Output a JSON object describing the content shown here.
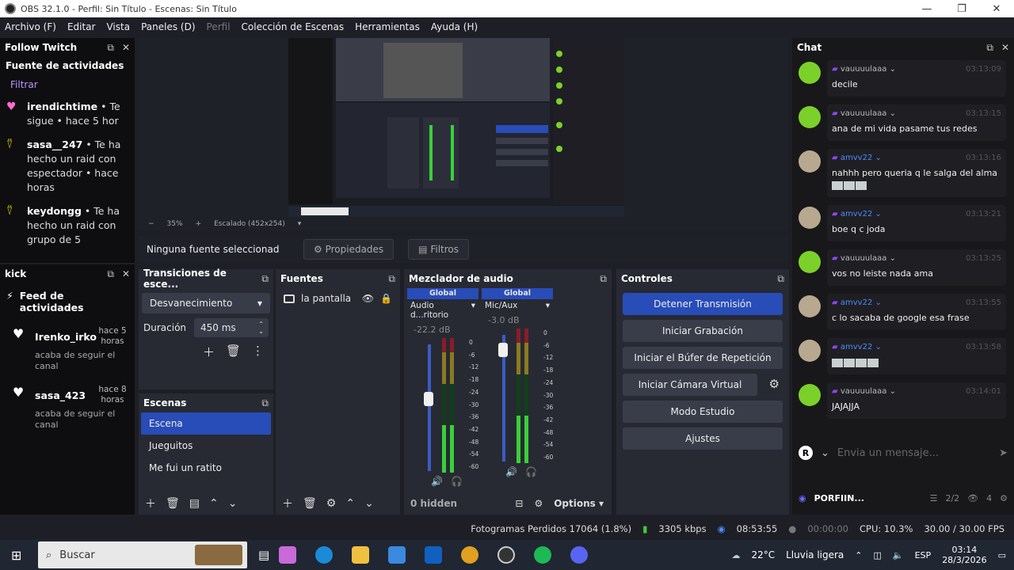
{
  "window": {
    "title": "OBS 32.1.0 - Perfil: Sin Título - Escenas: Sin Título",
    "minimize": "—",
    "maximize": "❐",
    "close": "✕"
  },
  "menu": [
    {
      "label": "Archivo (F)",
      "disabled": false
    },
    {
      "label": "Editar",
      "disabled": false
    },
    {
      "label": "Vista",
      "disabled": false
    },
    {
      "label": "Paneles (D)",
      "disabled": false
    },
    {
      "label": "Perfil",
      "disabled": true
    },
    {
      "label": "Colección de Escenas",
      "disabled": false
    },
    {
      "label": "Herramientas",
      "disabled": false
    },
    {
      "label": "Ayuda (H)",
      "disabled": false
    }
  ],
  "follow_dock": {
    "title": "Follow Twitch",
    "subtitle": "Fuente de actividades",
    "filter": "Filtrar",
    "items": [
      {
        "user": "irendichtime",
        "text": " • Te sigue • hace 5 hor",
        "type": "follow"
      },
      {
        "user": "sasa__247",
        "text": " • Te ha hecho un raid con espectador • hace horas",
        "type": "raid"
      },
      {
        "user": "keydongg",
        "text": " • Te ha hecho un raid con grupo de 5",
        "type": "raid"
      }
    ]
  },
  "kick_dock": {
    "title": "kick",
    "feed_title": "Feed de actividades",
    "items": [
      {
        "user": "Irenko_irko",
        "time": "hace 5 horas",
        "status": "acaba de seguir el canal"
      },
      {
        "user": "sasa_423",
        "time": "hace 8 horas",
        "status": "acaba de seguir el canal"
      }
    ]
  },
  "preview": {
    "zoom": "35%",
    "scaling": "Escalado (452x254)"
  },
  "source_bar": {
    "no_selection": "Ninguna fuente seleccionad",
    "properties": "Propiedades",
    "filters": "Filtros"
  },
  "transitions": {
    "title": "Transiciones de esce...",
    "selected": "Desvanecimiento",
    "duration_label": "Duración",
    "duration_value": "450 ms"
  },
  "scenes": {
    "title": "Escenas",
    "items": [
      "Escena",
      "Jueguitos",
      "Me fui un ratito"
    ],
    "active_index": 0
  },
  "sources": {
    "title": "Fuentes",
    "items": [
      "la pantalla"
    ]
  },
  "mixer": {
    "title": "Mezclador de audio",
    "hidden": "0 hidden",
    "options": "Options",
    "channels": [
      {
        "header": "Global",
        "name": "Audio d...ritorio",
        "db": "-22.2 dB",
        "volume": 0.6
      },
      {
        "header": "Global",
        "name": "Mic/Aux",
        "db": "-3.0 dB",
        "volume": 0.93
      }
    ],
    "ticks": [
      "0",
      "-6",
      "-12",
      "-18",
      "-24",
      "-30",
      "-36",
      "-42",
      "-48",
      "-54",
      "-60"
    ]
  },
  "controls": {
    "title": "Controles",
    "buttons": [
      "Detener Transmisión",
      "Iniciar Grabación",
      "Iniciar el Búfer de Repetición",
      "Iniciar Cámara Virtual",
      "Modo Estudio",
      "Ajustes"
    ]
  },
  "chat": {
    "title": "Chat",
    "messages": [
      {
        "user": "vauuuulaaa",
        "time": "03:13:09",
        "text": "decile",
        "avatar": "green",
        "emotes": 0
      },
      {
        "user": "vauuuulaaa",
        "time": "03:13:15",
        "text": "ana de mi vida pasame tus redes",
        "avatar": "green",
        "emotes": 0
      },
      {
        "user": "amvv22",
        "time": "03:13:16",
        "text": "nahhh pero queria q le salga del alma",
        "avatar": "photo",
        "emotes": 3
      },
      {
        "user": "amvv22",
        "time": "03:13:21",
        "text": "boe q c joda",
        "avatar": "photo",
        "emotes": 0
      },
      {
        "user": "vauuuulaaa",
        "time": "03:13:25",
        "text": "vos no leiste nada ama",
        "avatar": "green",
        "emotes": 0
      },
      {
        "user": "amvv22",
        "time": "03:13:55",
        "text": "c lo sacaba de google esa frase",
        "avatar": "photo",
        "emotes": 0
      },
      {
        "user": "amvv22",
        "time": "03:13:58",
        "text": "",
        "avatar": "photo",
        "emotes": 4
      },
      {
        "user": "vauuuulaaa",
        "time": "03:14:01",
        "text": "JAJAJJA",
        "avatar": "green",
        "emotes": 0
      }
    ],
    "input_placeholder": "Envia un mensaje...",
    "channel": "PORFIIN...",
    "count": "2/2",
    "viewers": "4"
  },
  "status": {
    "dropped": "Fotogramas Perdidos 17064 (1.8%)",
    "bitrate": "3305 kbps",
    "live_time": "08:53:55",
    "rec_time": "00:00:00",
    "cpu": "CPU: 10.3%",
    "fps": "30.00 / 30.00 FPS"
  },
  "taskbar": {
    "search": "Buscar",
    "weather_temp": "22°C",
    "weather_desc": "Lluvia ligera",
    "lang": "ESP",
    "time": "03:14",
    "date": "28/3/2026"
  }
}
